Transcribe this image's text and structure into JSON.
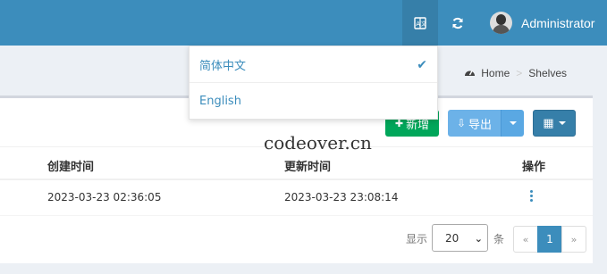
{
  "header": {
    "lang_icon": "translate-icon",
    "refresh_icon": "refresh-icon",
    "user_name": "Administrator"
  },
  "language_menu": {
    "items": [
      {
        "label": "简体中文",
        "selected": true
      },
      {
        "label": "English",
        "selected": false
      }
    ],
    "check_glyph": "✔"
  },
  "breadcrumb": {
    "home": "Home",
    "separator": ">",
    "current": "Shelves"
  },
  "toolbar": {
    "add_label": "新增",
    "add_glyph": "✚",
    "export_label": "导出",
    "export_glyph": "⇩",
    "columns_glyph": "▦"
  },
  "table": {
    "columns": [
      "创建时间",
      "更新时间",
      "操作"
    ],
    "rows": [
      {
        "created": "2023-03-23 02:36:05",
        "updated": "2023-03-23 23:08:14"
      }
    ]
  },
  "pagination": {
    "show_label": "显示",
    "page_size": "20",
    "unit_label": "条",
    "prev": "«",
    "current_page": "1",
    "next": "»"
  },
  "watermark": "codeover.cn",
  "colors": {
    "header": "#3c8dbc",
    "add_button": "#00a65a",
    "export_button": "#6cb2e8",
    "columns_button": "#367fa9"
  }
}
